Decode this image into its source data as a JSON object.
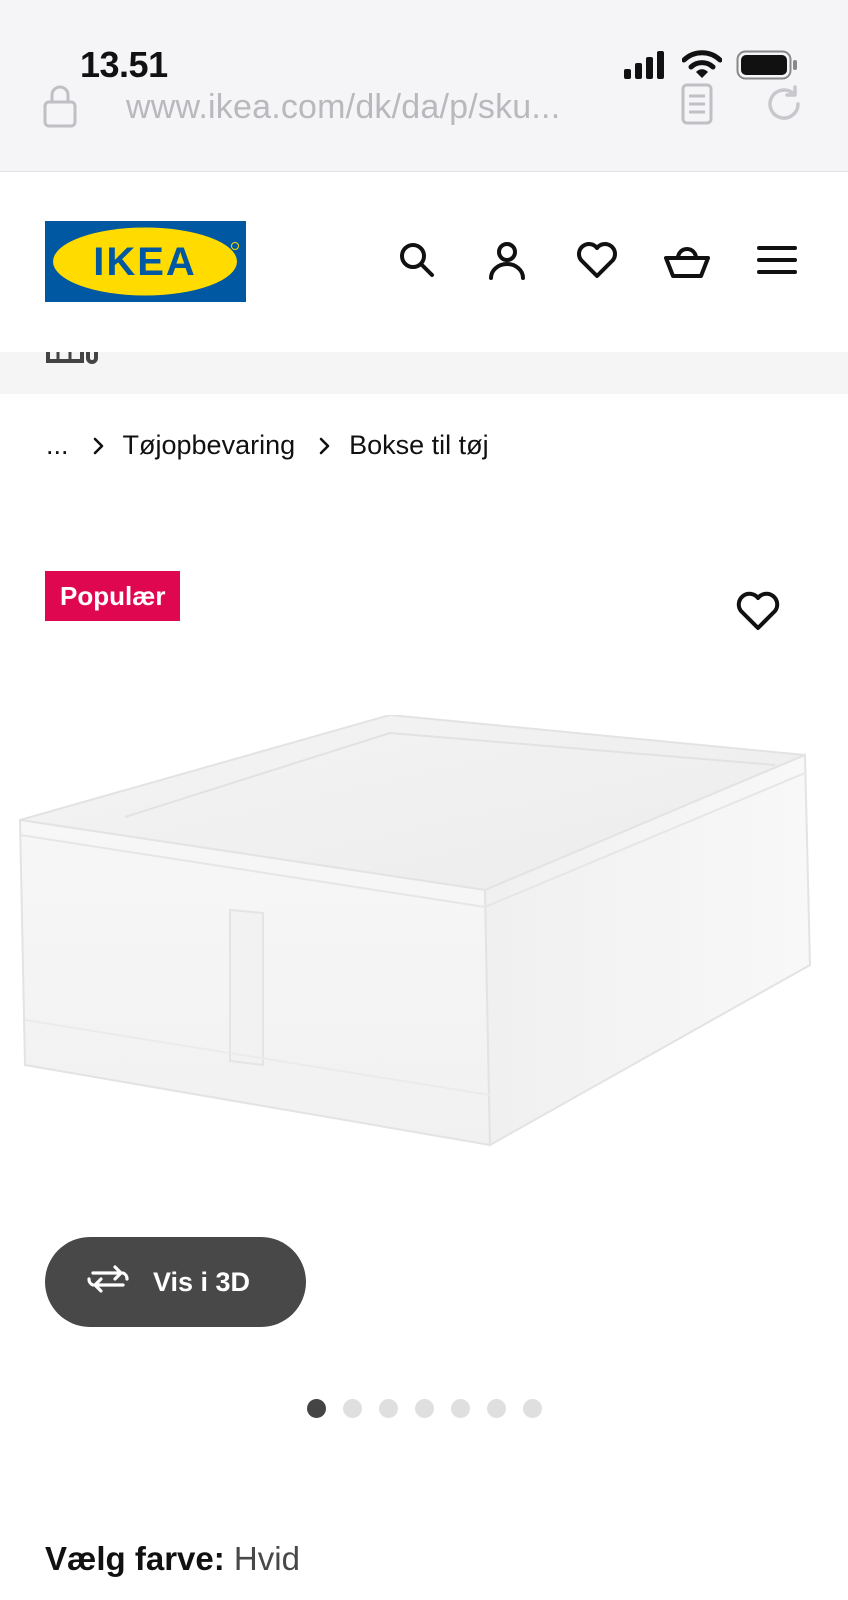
{
  "status_bar": {
    "time": "13.51"
  },
  "browser": {
    "url": "www.ikea.com/dk/da/p/sku..."
  },
  "header": {
    "logo_text": "IKEA",
    "icons": [
      "search-icon",
      "account-icon",
      "heart-icon",
      "basket-icon",
      "menu-icon"
    ]
  },
  "breadcrumb": {
    "ellipsis": "...",
    "items": [
      "Tøjopbevaring",
      "Bokse til tøj"
    ]
  },
  "product": {
    "badge": "Populær",
    "view_3d_label": "Vis i 3D",
    "carousel": {
      "total": 7,
      "active": 1
    },
    "color_label": "Vælg farve:",
    "color_value": "Hvid"
  },
  "colors": {
    "ikea_blue": "#0058a3",
    "ikea_yellow": "#ffdb00",
    "badge_pink": "#e00751",
    "button_dark": "#484848"
  }
}
